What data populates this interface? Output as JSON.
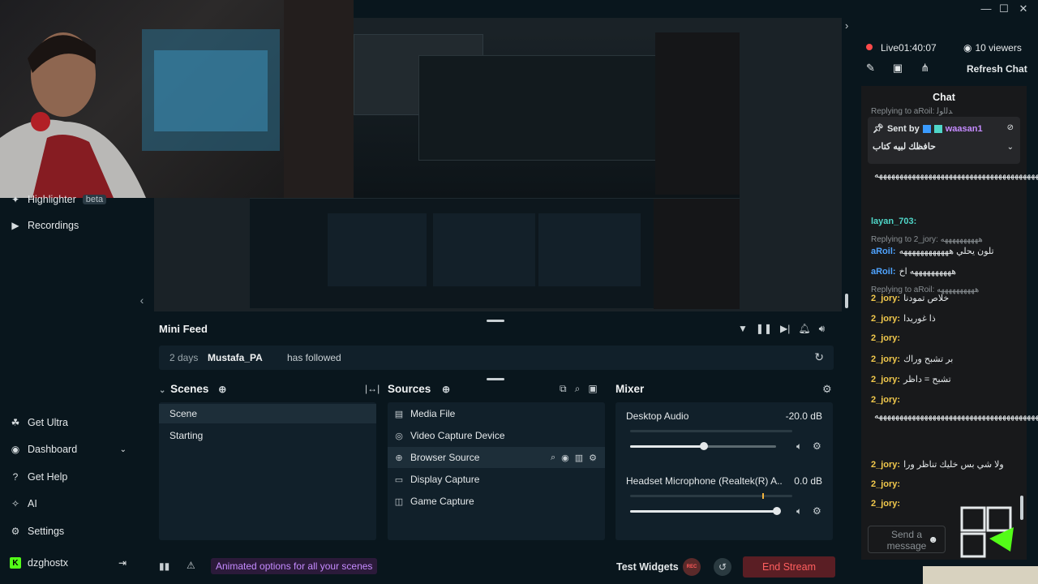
{
  "window": {
    "controls": [
      "—",
      "☐",
      "✕"
    ]
  },
  "nav": {
    "highlighter": "Highlighter",
    "highlighter_badge": "beta",
    "recordings": "Recordings",
    "get_ultra": "Get Ultra",
    "dashboard": "Dashboard",
    "get_help": "Get Help",
    "ai": "AI",
    "settings": "Settings",
    "username": "dzghostx"
  },
  "minifeed": {
    "title": "Mini Feed",
    "event": {
      "time": "2 days",
      "user": "Mustafa_PA",
      "action": "has followed"
    }
  },
  "scenes": {
    "title": "Scenes",
    "items": [
      {
        "label": "Scene",
        "active": true
      },
      {
        "label": "Starting",
        "active": false
      }
    ]
  },
  "sources": {
    "title": "Sources",
    "items": [
      {
        "label": "Media File",
        "icon": "file-icon"
      },
      {
        "label": "Video Capture Device",
        "icon": "camera-icon"
      },
      {
        "label": "Browser Source",
        "icon": "globe-icon"
      },
      {
        "label": "Display Capture",
        "icon": "monitor-icon"
      },
      {
        "label": "Game Capture",
        "icon": "gamepad-icon"
      }
    ]
  },
  "mixer": {
    "title": "Mixer",
    "channels": [
      {
        "name": "Desktop Audio",
        "db": "-20.0 dB",
        "level": 0.5
      },
      {
        "name": "Headset Microphone (Realtek(R) A...",
        "db": "0.0 dB",
        "level": 1.0
      }
    ]
  },
  "footer": {
    "animated_options": "Animated options for all your scenes",
    "test_widgets": "Test Widgets",
    "rec": "REC",
    "end_stream": "End Stream"
  },
  "stream": {
    "status": "Live",
    "time": "01:40:07",
    "viewers": "10 viewers",
    "refresh_chat": "Refresh Chat"
  },
  "chat": {
    "title": "Chat",
    "replying_top": "Replying to aRoil: ﺪﻟاﻮﻟ",
    "pinned_sender": "Sent by",
    "pinned_user": "waasan1",
    "pinned_text": "ﺣﺎﻓﻈﻚ ﻟﺒﻴﻪ ﻛﺘﺎب",
    "messages": [
      {
        "type": "text",
        "user": "",
        "text": "ههههههههههههههههههههههههههههههههههههههههه"
      },
      {
        "type": "text",
        "user": "layan_703:",
        "text": ""
      },
      {
        "type": "reply",
        "text": "Replying to 2_jory: ههههههههههه"
      },
      {
        "type": "text",
        "user": "aRoil:",
        "text": "ﺗﻠﻮن ﻳﺤﻠﻲ ههههههههههههه"
      },
      {
        "type": "text",
        "user": "aRoil:",
        "text": "ﻫﻬﻬﻬﻬﻬﻬﻬﻬﻬﻪ اخ"
      },
      {
        "type": "reply",
        "text": "Replying to aRoil: ههههههههههه"
      },
      {
        "type": "text",
        "user": "2_jory:",
        "text": "ﺧﻼص ﺗﻤﻮدﻧﺎ"
      },
      {
        "type": "text",
        "user": "2_jory:",
        "text": "ذا ﻏﻮرﻳﺪا"
      },
      {
        "type": "text",
        "user": "2_jory:",
        "text": ""
      },
      {
        "type": "text",
        "user": "2_jory:",
        "text": "ﺑﺮ ﺗﺸﺒﺢ وراك"
      },
      {
        "type": "text",
        "user": "2_jory:",
        "text": "ﺗﺸﺒﺢ = داﻇﺮ"
      },
      {
        "type": "text",
        "user": "2_jory:",
        "text": ""
      },
      {
        "type": "text",
        "user": "",
        "text": "ههههههههههههههههههههههههههههههههههههههههه"
      },
      {
        "type": "text",
        "user": "2_jory:",
        "text": "وﻻ ﺷﻲ ﺑﺲ ﺧﻠﻴﻚ ﺗﻨﺎﻇﺮ ورا"
      },
      {
        "type": "text",
        "user": "2_jory:",
        "text": ""
      },
      {
        "type": "text",
        "user": "2_jory:",
        "text": ""
      }
    ],
    "send_placeholder": "Send a message"
  },
  "colors": {
    "accent_green": "#31c3a2",
    "live_red": "#ff4a4a",
    "chat_user_yellow": "#f2c94c",
    "chat_user_blue": "#4fa3ff",
    "chat_user_teal": "#4fd6c8"
  }
}
